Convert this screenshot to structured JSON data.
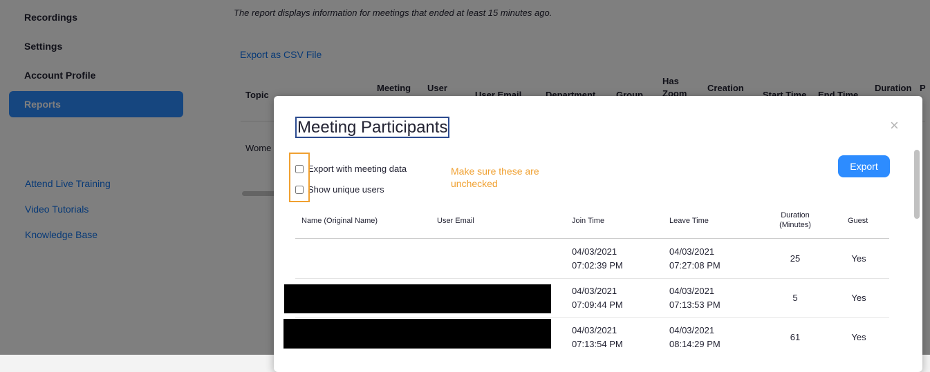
{
  "sidebar": {
    "items": [
      {
        "label": "Recordings",
        "active": false
      },
      {
        "label": "Settings",
        "active": false
      },
      {
        "label": "Account Profile",
        "active": false
      },
      {
        "label": "Reports",
        "active": true
      }
    ],
    "help_links": [
      "Attend Live Training",
      "Video Tutorials",
      "Knowledge Base"
    ]
  },
  "main": {
    "notice": "The report displays information for meetings that ended at least 15 minutes ago.",
    "export_csv": "Export as CSV File",
    "columns": [
      "Topic",
      "Meeting",
      "User",
      "User Email",
      "Department",
      "Group",
      "Has",
      "Zoom",
      "Creation",
      "Start Time",
      "End Time",
      "Duration",
      "P"
    ],
    "row_topic": "Wome"
  },
  "modal": {
    "title": "Meeting Participants",
    "options": [
      {
        "label": "Export with meeting data",
        "checked": false
      },
      {
        "label": "Show unique users",
        "checked": false
      }
    ],
    "annotation": "Make sure these are unchecked",
    "export_label": "Export",
    "close_symbol": "×",
    "table": {
      "headers": {
        "name": "Name (Original Name)",
        "email": "User Email",
        "join": "Join Time",
        "leave": "Leave Time",
        "duration": "Duration (Minutes)",
        "guest": "Guest"
      },
      "rows": [
        {
          "join_date": "04/03/2021",
          "join_time": "07:02:39 PM",
          "leave_date": "04/03/2021",
          "leave_time": "07:27:08 PM",
          "duration": "25",
          "guest": "Yes"
        },
        {
          "join_date": "04/03/2021",
          "join_time": "07:09:44 PM",
          "leave_date": "04/03/2021",
          "leave_time": "07:13:53 PM",
          "duration": "5",
          "guest": "Yes"
        },
        {
          "join_date": "04/03/2021",
          "join_time": "07:13:54 PM",
          "leave_date": "04/03/2021",
          "leave_time": "08:14:29 PM",
          "duration": "61",
          "guest": "Yes"
        }
      ]
    }
  },
  "colors": {
    "accent": "#2d8cff",
    "link": "#0e72ed",
    "annotation": "#f0a030"
  }
}
